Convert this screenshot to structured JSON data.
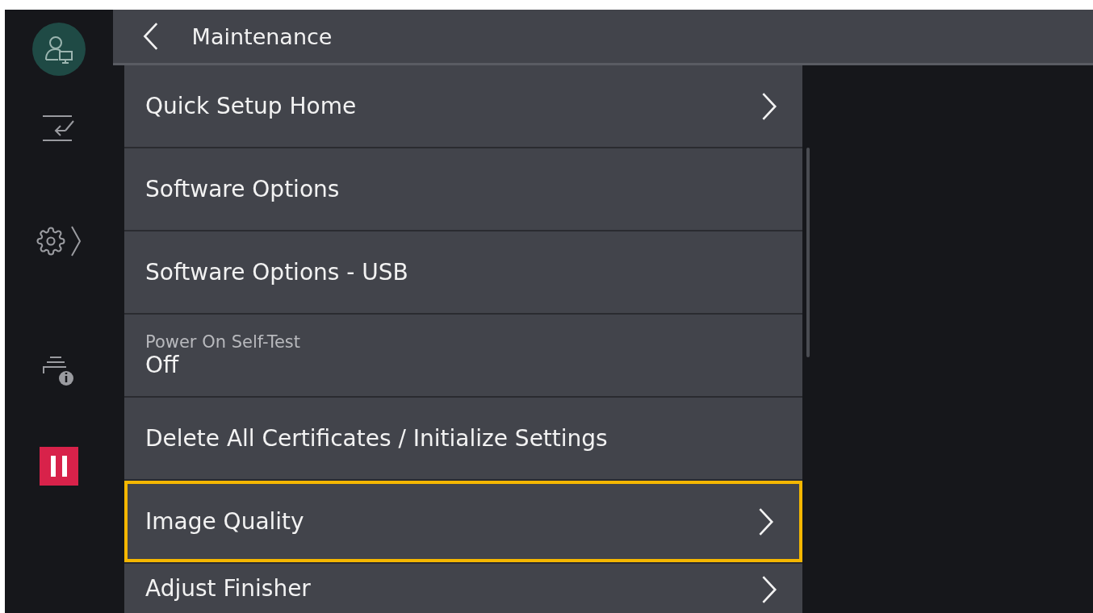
{
  "header": {
    "title": "Maintenance"
  },
  "items": [
    {
      "kind": "link",
      "label": "Quick Setup Home",
      "selected": false
    },
    {
      "kind": "plain",
      "label": "Software Options",
      "selected": false
    },
    {
      "kind": "plain",
      "label": "Software Options - USB",
      "selected": false
    },
    {
      "kind": "value",
      "label": "Power On Self-Test",
      "value": "Off",
      "selected": false
    },
    {
      "kind": "plain",
      "label": "Delete All Certificates / Initialize Settings",
      "selected": false
    },
    {
      "kind": "link",
      "label": "Image Quality",
      "selected": true
    },
    {
      "kind": "link",
      "label": "Adjust Finisher",
      "selected": false
    }
  ]
}
